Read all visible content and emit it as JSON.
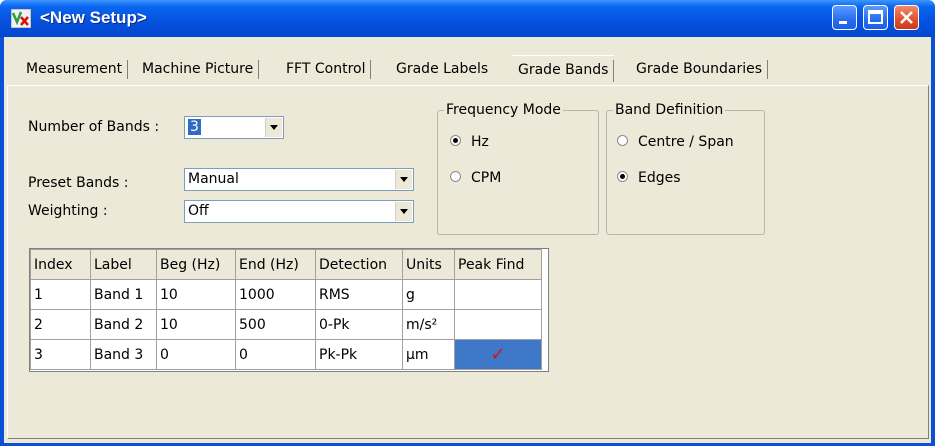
{
  "window": {
    "title": "<New Setup>",
    "app_icon": "vx-app-icon"
  },
  "tabs": [
    {
      "label": "Measurement"
    },
    {
      "label": "Machine Picture"
    },
    {
      "label": "FFT Control"
    },
    {
      "label": "Grade Labels"
    },
    {
      "label": "Grade Bands"
    },
    {
      "label": "Grade Boundaries"
    }
  ],
  "active_tab": "Grade Bands",
  "form": {
    "num_bands_label": "Number of Bands :",
    "num_bands_value": "3",
    "preset_label": "Preset Bands :",
    "preset_value": "Manual",
    "weighting_label": "Weighting :",
    "weighting_value": "Off"
  },
  "frequency_mode": {
    "title": "Frequency Mode",
    "options": [
      "Hz",
      "CPM"
    ],
    "selected": "Hz"
  },
  "band_definition": {
    "title": "Band Definition",
    "options": [
      "Centre / Span",
      "Edges"
    ],
    "selected": "Edges"
  },
  "table": {
    "headers": [
      "Index",
      "Label",
      "Beg (Hz)",
      "End (Hz)",
      "Detection",
      "Units",
      "Peak Find"
    ],
    "rows": [
      [
        "1",
        "Band 1",
        "10",
        "1000",
        "RMS",
        "g",
        ""
      ],
      [
        "2",
        "Band 2",
        "10",
        "500",
        "0-Pk",
        "m/s²",
        ""
      ],
      [
        "3",
        "Band 3",
        "0",
        "0",
        "Pk-Pk",
        "µm",
        "✓"
      ]
    ]
  },
  "colors": {
    "titlebar": "#0553e0",
    "selection": "#316ac5",
    "check": "#d81010"
  }
}
